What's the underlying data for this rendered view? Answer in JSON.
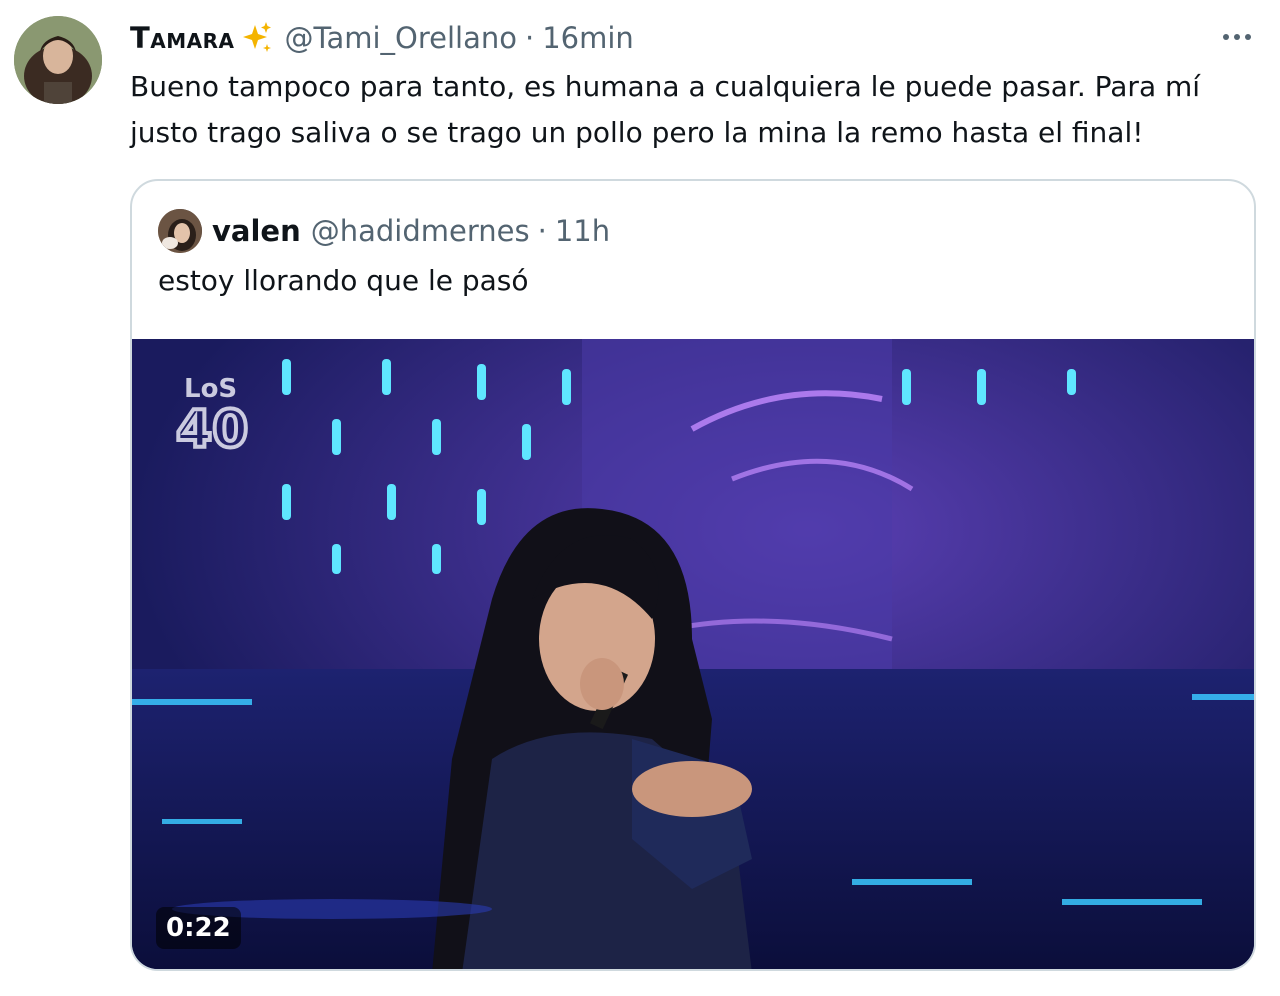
{
  "tweet": {
    "author_name": "Tamara",
    "handle": "@Tami_Orellano",
    "separator": "·",
    "time": "16min",
    "text": "Bueno tampoco para tanto, es humana a cualquiera le puede pasar. Para mí justo trago saliva o se trago un pollo pero la mina la remo hasta el final!",
    "more_icon": "more-horizontal-icon",
    "emoji_icon": "sparkles-icon"
  },
  "quoted": {
    "author_name": "valen",
    "handle": "@hadidmernes",
    "separator": "·",
    "time": "11h",
    "text": "estoy llorando que le pasó",
    "video": {
      "duration": "0:22",
      "watermark": "LOS 40"
    }
  },
  "colors": {
    "text": "#0f1419",
    "secondary": "#536471",
    "border": "#cfd9de",
    "sparkle": "#f4b400",
    "stage_bg": "#1a1b5e"
  }
}
